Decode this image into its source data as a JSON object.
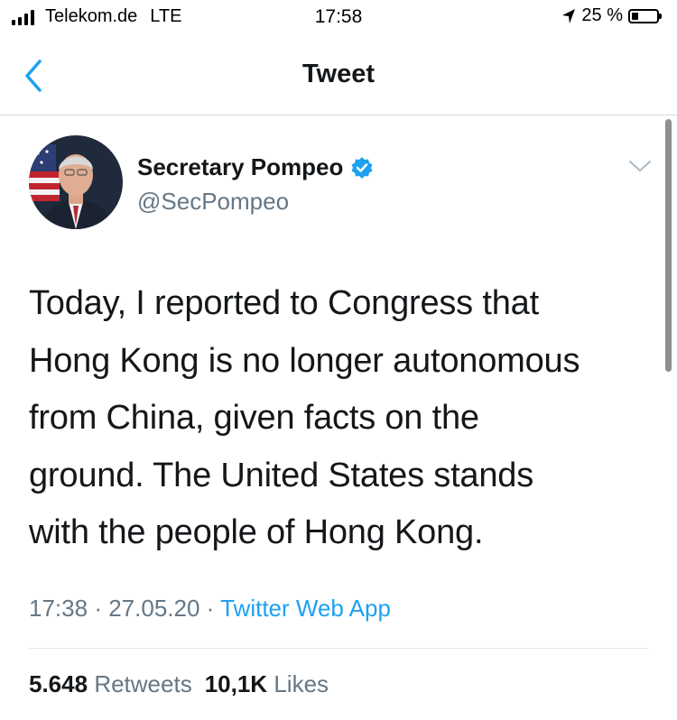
{
  "status_bar": {
    "carrier": "Telekom.de",
    "network": "LTE",
    "time": "17:58",
    "battery_text": "25 %",
    "battery_level_percent": 25,
    "icons": [
      "signal-bars-icon",
      "location-arrow-icon",
      "battery-icon"
    ]
  },
  "nav": {
    "title": "Tweet",
    "back_icon": "chevron-left-icon",
    "accent_color": "#1da1f2"
  },
  "tweet": {
    "author_name": "Secretary Pompeo",
    "author_handle": "@SecPompeo",
    "verified_icon": "verified-badge-icon",
    "menu_icon": "chevron-down-icon",
    "text_lines": [
      "Today, I reported to Congress that",
      "Hong Kong is no longer autonomous",
      "from China, given facts on the",
      "ground. The United States stands",
      "with the people of Hong Kong."
    ],
    "time": "17:38",
    "date": "27.05.20",
    "separator": "·",
    "source": "Twitter Web App",
    "retweets_count": "5.648",
    "retweets_label": "Retweets",
    "likes_count": "10,1K",
    "likes_label": "Likes"
  },
  "colors": {
    "text_primary": "#14171a",
    "text_secondary": "#657786",
    "link": "#1da1f2",
    "divider": "#e1e8ed"
  }
}
